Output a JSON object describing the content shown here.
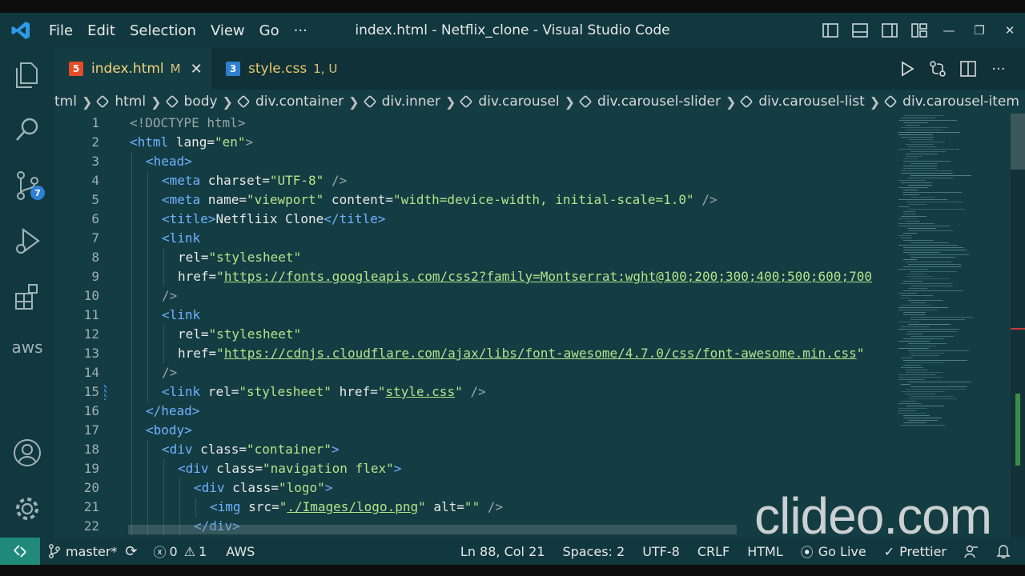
{
  "titlebar": {
    "menu": [
      "File",
      "Edit",
      "Selection",
      "View",
      "Go",
      "···"
    ],
    "title": "index.html - Netflix_clone - Visual Studio Code"
  },
  "activity": {
    "scm_badge": "7",
    "aws_label": "aws"
  },
  "tabs": [
    {
      "label": "index.html",
      "mark": "M",
      "icon_text": "5"
    },
    {
      "label": "style.css",
      "mark": "1, U",
      "icon_text": "3"
    }
  ],
  "breadcrumb": [
    "tml",
    "html",
    "body",
    "div.container",
    "div.inner",
    "div.carousel",
    "div.carousel-slider",
    "div.carousel-list",
    "div.carousel-item"
  ],
  "code_lines": [
    {
      "n": "1"
    },
    {
      "n": "2"
    },
    {
      "n": "3"
    },
    {
      "n": "4"
    },
    {
      "n": "5"
    },
    {
      "n": "6"
    },
    {
      "n": "7"
    },
    {
      "n": "8"
    },
    {
      "n": "9"
    },
    {
      "n": "10"
    },
    {
      "n": "11"
    },
    {
      "n": "12"
    },
    {
      "n": "13"
    },
    {
      "n": "14"
    },
    {
      "n": "15"
    },
    {
      "n": "16"
    },
    {
      "n": "17"
    },
    {
      "n": "18"
    },
    {
      "n": "19"
    },
    {
      "n": "20"
    },
    {
      "n": "21"
    },
    {
      "n": "22"
    }
  ],
  "code": {
    "doctype": "<!DOCTYPE html>",
    "l2_tag": "<html",
    "l2_attr": " lang=",
    "l2_val": "\"en\"",
    "l2_close": ">",
    "l3": "<head>",
    "l4_tag": "<meta",
    "l4_attr": " charset=",
    "l4_val": "\"UTF-8\"",
    "l4_close": " />",
    "l5_tag": "<meta",
    "l5_attr1": " name=",
    "l5_val1": "\"viewport\"",
    "l5_attr2": " content=",
    "l5_val2": "\"width=device-width, initial-scale=1.0\"",
    "l5_close": " />",
    "l6_open": "<title>",
    "l6_text": "Netfliix Clone",
    "l6_close": "</title>",
    "l7": "<link",
    "l8_attr": "rel=",
    "l8_val": "\"stylesheet\"",
    "l9_attr": "href=",
    "l9_q": "\"",
    "l9_url": "https://fonts.googleapis.com/css2?family=Montserrat:wght@100;200;300;400;500;600;700",
    "l10": "/>",
    "l11": "<link",
    "l12_attr": "rel=",
    "l12_val": "\"stylesheet\"",
    "l13_attr": "href=",
    "l13_q": "\"",
    "l13_url": "https://cdnjs.cloudflare.com/ajax/libs/font-awesome/4.7.0/css/font-awesome.min.css",
    "l13_q2": "\"",
    "l14": "/>",
    "l15_tag": "<link",
    "l15_attr1": " rel=",
    "l15_val1": "\"stylesheet\"",
    "l15_attr2": " href=",
    "l15_q": "\"",
    "l15_url": "style.css",
    "l15_q2": "\"",
    "l15_close": " />",
    "l16": "</head>",
    "l17": "<body>",
    "l18_tag": "<div",
    "l18_attr": " class=",
    "l18_val": "\"container\"",
    "l18_close": ">",
    "l19_tag": "<div",
    "l19_attr": " class=",
    "l19_val": "\"navigation flex\"",
    "l19_close": ">",
    "l20_tag": "<div",
    "l20_attr": " class=",
    "l20_val": "\"logo\"",
    "l20_close": ">",
    "l21_tag": "<img",
    "l21_attr1": " src=",
    "l21_q": "\"",
    "l21_url": "./Images/logo.png",
    "l21_q2": "\"",
    "l21_attr2": " alt=",
    "l21_val2": "\"\"",
    "l21_close": " />",
    "l22": "</div>"
  },
  "statusbar": {
    "branch": "master*",
    "errors": "0",
    "warnings": "1",
    "aws": "AWS",
    "position": "Ln 88, Col 21",
    "spaces": "Spaces: 2",
    "encoding": "UTF-8",
    "eol": "CRLF",
    "language": "HTML",
    "golive": "Go Live",
    "prettier": "Prettier"
  },
  "watermark": "clideo.com",
  "colors": {
    "tag": "#6fb2ff",
    "string": "#b6e28a",
    "background": "#143c43",
    "bars": "#11383f"
  }
}
